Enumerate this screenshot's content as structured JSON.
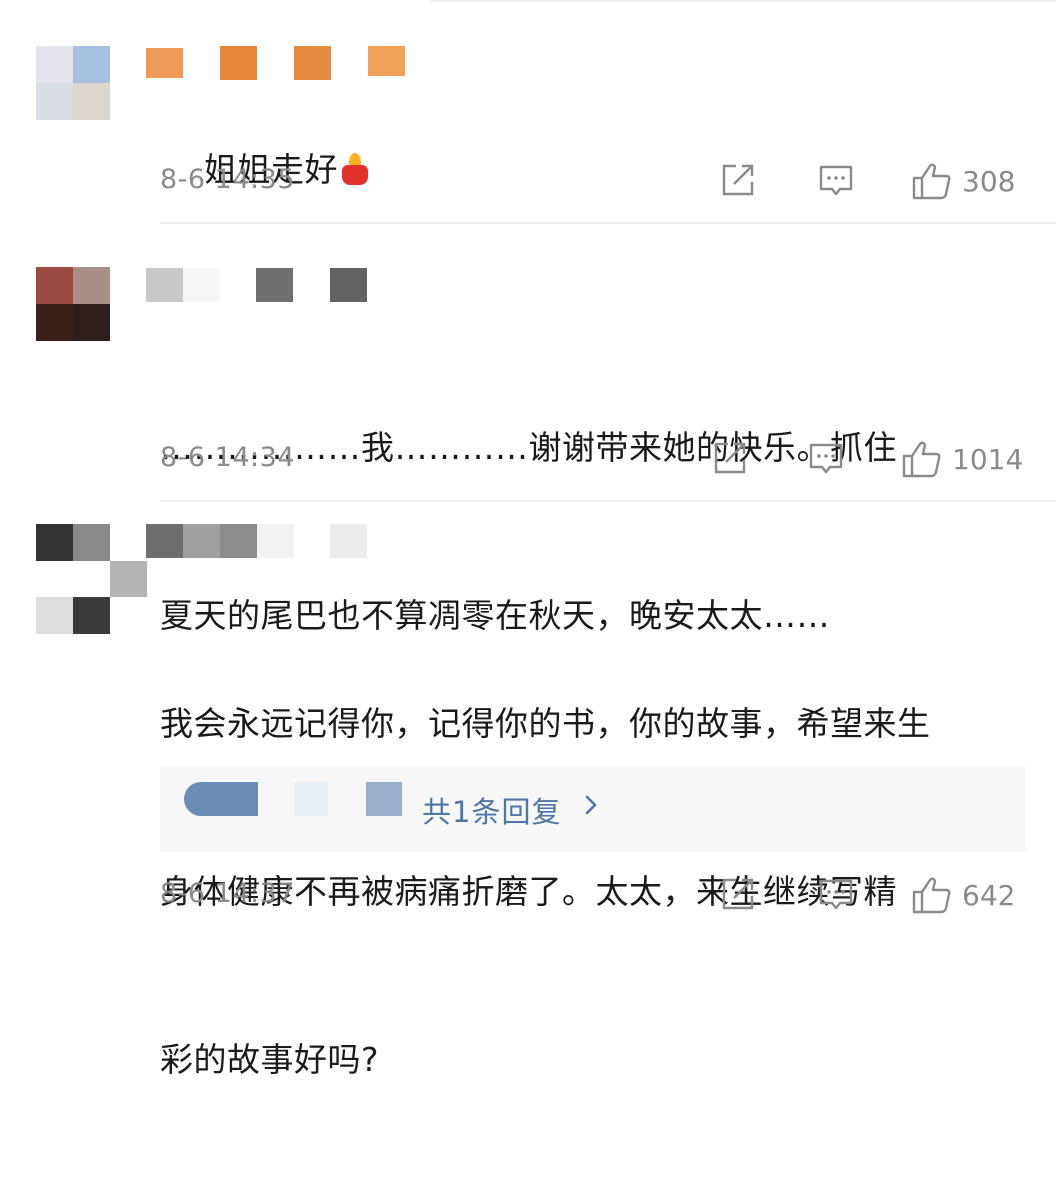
{
  "comments": [
    {
      "text": "姐姐走好",
      "emoji": "candle-emoji",
      "timestamp": "8-6 14:35",
      "likes": "308",
      "avatar_colors": [
        "#e4e4ee",
        "#a8c0e0",
        "#d8dde4",
        "#ddd6cf"
      ],
      "name_colors": [
        "#f09a58",
        "#e8873a",
        "#e68a40",
        "#f0a058"
      ]
    },
    {
      "text": "………………我…………谢谢带来她的快乐。抓住夏天的尾巴也不算凋零在秋天，晚安太太……",
      "text_lines": [
        "………………我…………谢谢带来她的快乐。抓住",
        "夏天的尾巴也不算凋零在秋天，晚安太太……"
      ],
      "timestamp": "8-6 14:34",
      "likes": "1014",
      "avatar_colors": [
        "#9a4a40",
        "#a89088",
        "#3a1e18",
        "#2e1e1c"
      ],
      "name_colors": [
        "#c8c8c8",
        "#f6f6f6",
        "#707070",
        "#626262"
      ]
    },
    {
      "text": "我会永远记得你，记得你的书，你的故事，希望来生身体健康不再被病痛折磨了。太太，来生继续写精彩的故事好吗?",
      "text_lines": [
        "我会永远记得你，记得你的书，你的故事，希望来生",
        "身体健康不再被病痛折磨了。太太，来生继续写精",
        "彩的故事好吗?"
      ],
      "timestamp": "8-6 14:37",
      "likes": "642",
      "avatar_colors": [
        "#333333",
        "#8a8a8a",
        "#dddddd",
        "#3a3a3a"
      ],
      "name_colors": [
        "#6e6e6e",
        "#a0a0a0",
        "#8c8c8c",
        "#f2f2f2",
        "#ececec"
      ],
      "reply_label": "共1条回复",
      "reply_colors": [
        "#6a8cb8",
        "#e8f0f6",
        "#9ab0ca"
      ]
    }
  ],
  "icons": {
    "share": "share-icon",
    "comment": "comment-icon",
    "like": "thumbs-up-icon",
    "chevron": "chevron-right-icon"
  },
  "colors": {
    "meta_text": "#8a8a8a",
    "reply_link": "#4f76a8",
    "reply_bg": "#f7f7f7",
    "divider": "#eeeeee"
  }
}
